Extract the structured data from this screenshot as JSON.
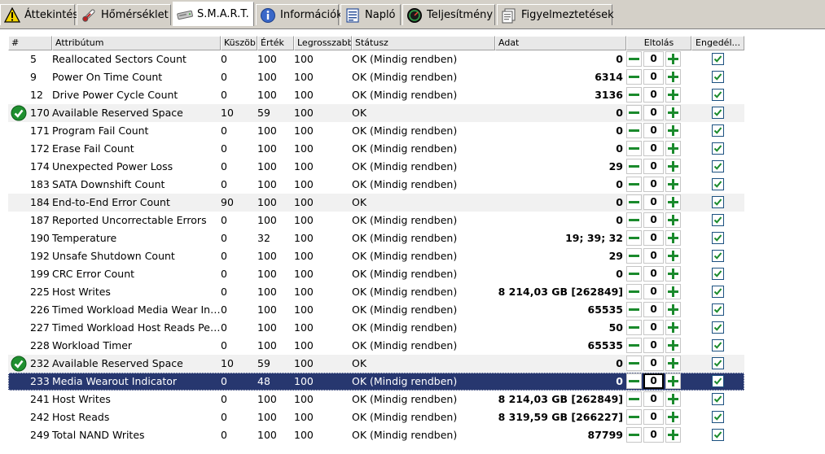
{
  "tabs": [
    {
      "label": "Áttekintés",
      "icon": "warning-icon",
      "active": false
    },
    {
      "label": "Hőmérséklet",
      "icon": "thermometer-icon",
      "active": false
    },
    {
      "label": "S.M.A.R.T.",
      "icon": "hard-drive-icon",
      "active": true
    },
    {
      "label": "Információk",
      "icon": "info-icon",
      "active": false
    },
    {
      "label": "Napló",
      "icon": "log-icon",
      "active": false
    },
    {
      "label": "Teljesítmény",
      "icon": "gauge-icon",
      "active": false
    },
    {
      "label": "Figyelmeztetések",
      "icon": "alerts-icon",
      "active": false
    }
  ],
  "columns": {
    "num": "#",
    "attribute": "Attribútum",
    "threshold": "Küszöb",
    "value": "Érték",
    "worst": "Legrosszabb",
    "status": "Státusz",
    "data": "Adat",
    "offset": "Eltolás",
    "enabled": "Engedél..."
  },
  "colors": {
    "selection": "#27376f",
    "ok_green": "#1a8a2c",
    "alt_row": "#f1f1f1"
  },
  "rows": [
    {
      "id": "5",
      "attr": "Reallocated Sectors Count",
      "thr": "0",
      "val": "100",
      "worst": "100",
      "status": "OK (Mindig rendben)",
      "data": "0",
      "offset": "0",
      "ok_icon": false,
      "selected": false
    },
    {
      "id": "9",
      "attr": "Power On Time Count",
      "thr": "0",
      "val": "100",
      "worst": "100",
      "status": "OK (Mindig rendben)",
      "data": "6314",
      "offset": "0",
      "ok_icon": false,
      "selected": false
    },
    {
      "id": "12",
      "attr": "Drive Power Cycle Count",
      "thr": "0",
      "val": "100",
      "worst": "100",
      "status": "OK (Mindig rendben)",
      "data": "3136",
      "offset": "0",
      "ok_icon": false,
      "selected": false
    },
    {
      "id": "170",
      "attr": "Available Reserved Space",
      "thr": "10",
      "val": "59",
      "worst": "100",
      "status": "OK",
      "data": "0",
      "offset": "0",
      "ok_icon": true,
      "selected": false
    },
    {
      "id": "171",
      "attr": "Program Fail Count",
      "thr": "0",
      "val": "100",
      "worst": "100",
      "status": "OK (Mindig rendben)",
      "data": "0",
      "offset": "0",
      "ok_icon": false,
      "selected": false
    },
    {
      "id": "172",
      "attr": "Erase Fail Count",
      "thr": "0",
      "val": "100",
      "worst": "100",
      "status": "OK (Mindig rendben)",
      "data": "0",
      "offset": "0",
      "ok_icon": false,
      "selected": false
    },
    {
      "id": "174",
      "attr": "Unexpected Power Loss",
      "thr": "0",
      "val": "100",
      "worst": "100",
      "status": "OK (Mindig rendben)",
      "data": "29",
      "offset": "0",
      "ok_icon": false,
      "selected": false
    },
    {
      "id": "183",
      "attr": "SATA Downshift Count",
      "thr": "0",
      "val": "100",
      "worst": "100",
      "status": "OK (Mindig rendben)",
      "data": "0",
      "offset": "0",
      "ok_icon": false,
      "selected": false
    },
    {
      "id": "184",
      "attr": "End-to-End Error Count",
      "thr": "90",
      "val": "100",
      "worst": "100",
      "status": "OK",
      "data": "0",
      "offset": "0",
      "ok_icon": false,
      "selected": false
    },
    {
      "id": "187",
      "attr": "Reported Uncorrectable Errors",
      "thr": "0",
      "val": "100",
      "worst": "100",
      "status": "OK (Mindig rendben)",
      "data": "0",
      "offset": "0",
      "ok_icon": false,
      "selected": false
    },
    {
      "id": "190",
      "attr": "Temperature",
      "thr": "0",
      "val": "32",
      "worst": "100",
      "status": "OK (Mindig rendben)",
      "data": "19; 39; 32",
      "offset": "0",
      "ok_icon": false,
      "selected": false
    },
    {
      "id": "192",
      "attr": "Unsafe Shutdown Count",
      "thr": "0",
      "val": "100",
      "worst": "100",
      "status": "OK (Mindig rendben)",
      "data": "29",
      "offset": "0",
      "ok_icon": false,
      "selected": false
    },
    {
      "id": "199",
      "attr": "CRC Error Count",
      "thr": "0",
      "val": "100",
      "worst": "100",
      "status": "OK (Mindig rendben)",
      "data": "0",
      "offset": "0",
      "ok_icon": false,
      "selected": false
    },
    {
      "id": "225",
      "attr": "Host Writes",
      "thr": "0",
      "val": "100",
      "worst": "100",
      "status": "OK (Mindig rendben)",
      "data": "8 214,03 GB [262849]",
      "offset": "0",
      "ok_icon": false,
      "selected": false
    },
    {
      "id": "226",
      "attr": "Timed Workload Media Wear Ind...",
      "thr": "0",
      "val": "100",
      "worst": "100",
      "status": "OK (Mindig rendben)",
      "data": "65535",
      "offset": "0",
      "ok_icon": false,
      "selected": false
    },
    {
      "id": "227",
      "attr": "Timed Workload Host Reads Perc...",
      "thr": "0",
      "val": "100",
      "worst": "100",
      "status": "OK (Mindig rendben)",
      "data": "50",
      "offset": "0",
      "ok_icon": false,
      "selected": false
    },
    {
      "id": "228",
      "attr": "Workload Timer",
      "thr": "0",
      "val": "100",
      "worst": "100",
      "status": "OK (Mindig rendben)",
      "data": "65535",
      "offset": "0",
      "ok_icon": false,
      "selected": false
    },
    {
      "id": "232",
      "attr": "Available Reserved Space",
      "thr": "10",
      "val": "59",
      "worst": "100",
      "status": "OK",
      "data": "0",
      "offset": "0",
      "ok_icon": true,
      "selected": false
    },
    {
      "id": "233",
      "attr": "Media Wearout Indicator",
      "thr": "0",
      "val": "48",
      "worst": "100",
      "status": "OK (Mindig rendben)",
      "data": "0",
      "offset": "0",
      "ok_icon": false,
      "selected": true
    },
    {
      "id": "241",
      "attr": "Host Writes",
      "thr": "0",
      "val": "100",
      "worst": "100",
      "status": "OK (Mindig rendben)",
      "data": "8 214,03 GB [262849]",
      "offset": "0",
      "ok_icon": false,
      "selected": false
    },
    {
      "id": "242",
      "attr": "Host Reads",
      "thr": "0",
      "val": "100",
      "worst": "100",
      "status": "OK (Mindig rendben)",
      "data": "8 319,59 GB [266227]",
      "offset": "0",
      "ok_icon": false,
      "selected": false
    },
    {
      "id": "249",
      "attr": "Total NAND Writes",
      "thr": "0",
      "val": "100",
      "worst": "100",
      "status": "OK (Mindig rendben)",
      "data": "87799",
      "offset": "0",
      "ok_icon": false,
      "selected": false
    }
  ]
}
